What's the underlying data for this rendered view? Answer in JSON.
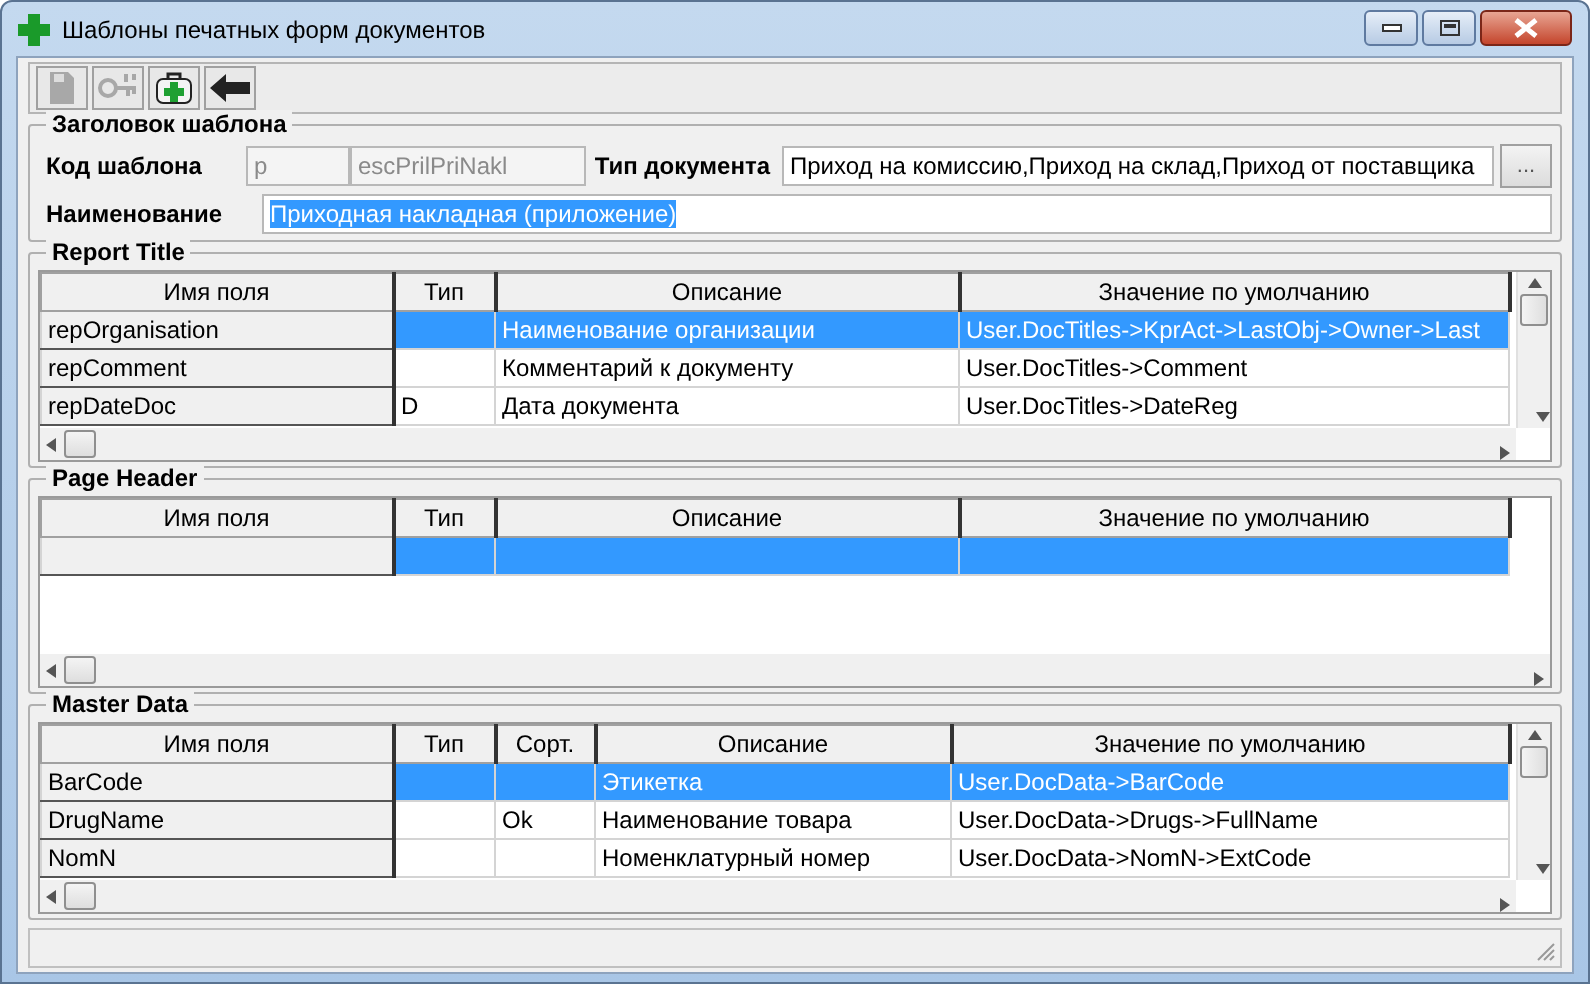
{
  "window": {
    "title": "Шаблоны печатных форм документов"
  },
  "toolbar": [
    {
      "kind": "save",
      "disabled": true
    },
    {
      "kind": "keys",
      "disabled": true
    },
    {
      "kind": "add",
      "disabled": false
    },
    {
      "kind": "back",
      "disabled": false
    }
  ],
  "header": {
    "title": "Заголовок шаблона",
    "code_label": "Код шаблона",
    "code_prefix": "p",
    "code_value": "escPrilPriNakl",
    "code_disabled": true,
    "doc_type_label": "Тип документа",
    "doc_type_value": "Приход на комиссию,Приход на склад,Приход от поставщика",
    "browse_button": "...",
    "name_label": "Наименование",
    "name_value": "Приходная накладная (приложение)",
    "name_text_selected": true
  },
  "sections": [
    {
      "title": "Report Title",
      "vertical_scroll": true,
      "columns": [
        "Имя поля",
        "Тип",
        "Описание",
        "Значение по умолчанию"
      ],
      "rows": [
        {
          "cells": [
            "repOrganisation",
            "",
            "Наименование организации",
            "User.DocTitles->KprAct->LastObj->Owner->Last"
          ],
          "selected": true
        },
        {
          "cells": [
            "repComment",
            "",
            "Комментарий к документу",
            "User.DocTitles->Comment"
          ],
          "selected": false
        },
        {
          "cells": [
            "repDateDoc",
            "D",
            "Дата документа",
            "User.DocTitles->DateReg"
          ],
          "selected": false
        }
      ]
    },
    {
      "title": "Page Header",
      "vertical_scroll": false,
      "columns": [
        "Имя поля",
        "Тип",
        "Описание",
        "Значение по умолчанию"
      ],
      "rows": [
        {
          "cells": [
            "",
            "",
            "",
            ""
          ],
          "selected": true
        }
      ]
    },
    {
      "title": "Master Data",
      "vertical_scroll": true,
      "columns": [
        "Имя поля",
        "Тип",
        "Сорт.",
        "Описание",
        "Значение по умолчанию"
      ],
      "rows": [
        {
          "cells": [
            "BarCode",
            "",
            "",
            "Этикетка",
            "User.DocData->BarCode"
          ],
          "selected": true
        },
        {
          "cells": [
            "DrugName",
            "",
            "Ok",
            "Наименование товара",
            "User.DocData->Drugs->FullName"
          ],
          "selected": false
        },
        {
          "cells": [
            "NomN",
            "",
            "",
            "Номенклатурный номер",
            "User.DocData->NomN->ExtCode"
          ],
          "selected": false
        }
      ]
    }
  ]
}
